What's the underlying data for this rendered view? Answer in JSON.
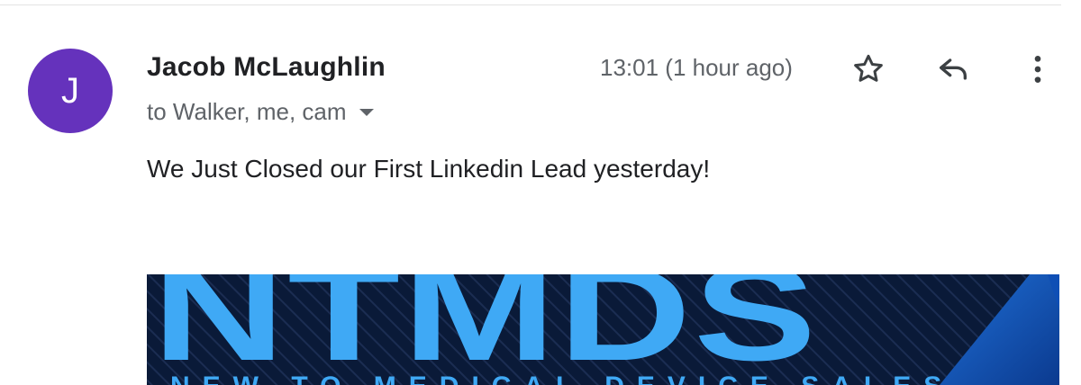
{
  "email": {
    "avatar_letter": "J",
    "sender_name": "Jacob McLaughlin",
    "recipients": "to Walker, me, cam",
    "timestamp": "13:01 (1 hour ago)",
    "body": "We Just Closed our First Linkedin Lead yesterday!"
  },
  "actions": {
    "star_icon": "star-outline-icon",
    "reply_icon": "reply-arrow-icon",
    "more_icon": "vertical-dots-icon"
  },
  "banner": {
    "logo_text": "NTMDS",
    "tagline": "NEW TO MEDICAL DEVICE SALES"
  },
  "colors": {
    "avatar_bg": "#6532bc",
    "banner_bg": "#0a1a38",
    "banner_accent": "#3fa9f5"
  }
}
